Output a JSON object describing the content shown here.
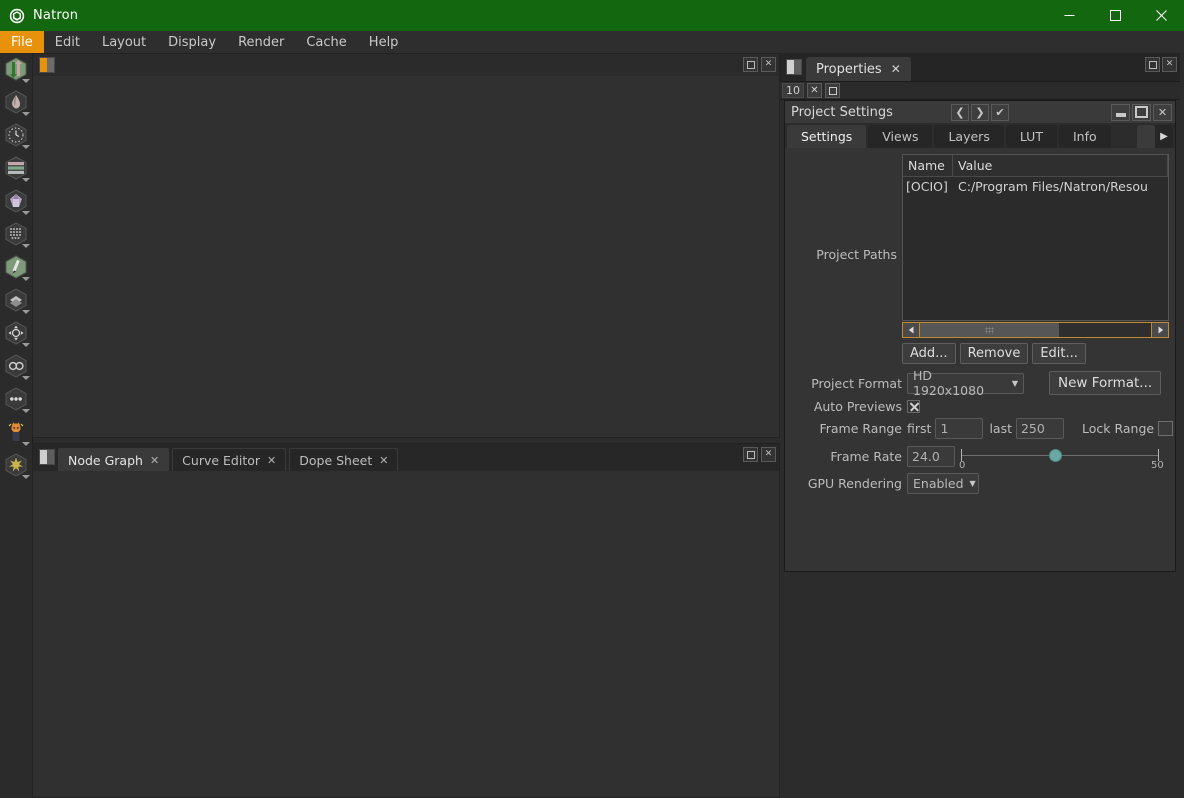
{
  "window": {
    "app_title": "Natron",
    "app_icon": "natron-logo-icon",
    "minimize_glyph": "—",
    "maximize_glyph": "☐",
    "close_glyph": "✕",
    "titlebar_color": "#13670f"
  },
  "menubar": {
    "items": [
      {
        "label": "File",
        "active": true
      },
      {
        "label": "Edit",
        "active": false
      },
      {
        "label": "Layout",
        "active": false
      },
      {
        "label": "Display",
        "active": false
      },
      {
        "label": "Render",
        "active": false
      },
      {
        "label": "Cache",
        "active": false
      },
      {
        "label": "Help",
        "active": false
      }
    ],
    "active_color": "#e8920c"
  },
  "left_toolbar": {
    "items": [
      {
        "name": "image-tools",
        "icon": "arrows-up-down-icon"
      },
      {
        "name": "draw-tools",
        "icon": "paint-drop-icon"
      },
      {
        "name": "time-tools",
        "icon": "clock-icon"
      },
      {
        "name": "channel-tools",
        "icon": "layers-stack-icon"
      },
      {
        "name": "color-tools",
        "icon": "color-gem-icon"
      },
      {
        "name": "filter-tools",
        "icon": "grid-mesh-icon"
      },
      {
        "name": "keyer-tools",
        "icon": "pen-icon"
      },
      {
        "name": "merge-tools",
        "icon": "sheets-icon"
      },
      {
        "name": "transform-tools",
        "icon": "transform-arrows-icon"
      },
      {
        "name": "views-tools",
        "icon": "stereo-glasses-icon"
      },
      {
        "name": "other-tools",
        "icon": "ellipsis-icon"
      },
      {
        "name": "extra-tools",
        "icon": "character-icon"
      },
      {
        "name": "misc-tools",
        "icon": "star-burst-icon"
      }
    ]
  },
  "viewer_pane": {
    "pane_icon": "split-pane-icon",
    "float_glyph": "▣",
    "close_glyph": "✕"
  },
  "bottom_pane": {
    "pane_icon": "split-pane-icon",
    "float_glyph": "▣",
    "close_glyph": "✕",
    "tabs": [
      {
        "label": "Node Graph",
        "selected": true,
        "close": "✕"
      },
      {
        "label": "Curve Editor",
        "selected": false,
        "close": "✕"
      },
      {
        "label": "Dope Sheet",
        "selected": false,
        "close": "✕"
      }
    ]
  },
  "properties_dock": {
    "pane_icon": "split-pane-icon",
    "tab_label": "Properties",
    "tab_close": "✕",
    "float_glyph": "▣",
    "close_glyph": "✕",
    "max_panels_value": "10",
    "clear_all_glyph": "✕",
    "minimize_all_glyph": "▣"
  },
  "project_settings": {
    "title": "Project Settings",
    "nav_prev_glyph": "❮",
    "nav_next_glyph": "❯",
    "center_glyph": "✔",
    "minimize_glyph": "_",
    "restore_glyph": "▣",
    "close_glyph": "✕",
    "tabs": [
      {
        "label": "Settings",
        "selected": true
      },
      {
        "label": "Views",
        "selected": false
      },
      {
        "label": "Layers",
        "selected": false
      },
      {
        "label": "LUT",
        "selected": false
      },
      {
        "label": "Info",
        "selected": false
      }
    ],
    "more_tabs_glyph": "▶",
    "project_paths": {
      "label": "Project Paths",
      "columns": [
        "Name",
        "Value"
      ],
      "rows": [
        {
          "name": "[OCIO]",
          "value": "C:/Program Files/Natron/Resou"
        }
      ],
      "scroll_left_glyph": "◀",
      "scroll_right_glyph": "▶",
      "buttons": [
        {
          "label": "Add..."
        },
        {
          "label": "Remove"
        },
        {
          "label": "Edit..."
        }
      ]
    },
    "project_format": {
      "label": "Project Format",
      "value": "HD 1920x1080",
      "dropdown_glyph": "▼",
      "new_format_label": "New Format..."
    },
    "auto_previews": {
      "label": "Auto Previews",
      "checked": true
    },
    "frame_range": {
      "label": "Frame Range",
      "first_label": "first",
      "first_value": "1",
      "last_label": "last",
      "last_value": "250",
      "lock_label": "Lock Range",
      "locked": false
    },
    "frame_rate": {
      "label": "Frame Rate",
      "value": "24.0",
      "slider_min": "0",
      "slider_max": "50",
      "slider_value": 24.0,
      "handle_color": "#6aa9a1"
    },
    "gpu_rendering": {
      "label": "GPU Rendering",
      "value": "Enabled",
      "dropdown_glyph": "▼"
    }
  }
}
